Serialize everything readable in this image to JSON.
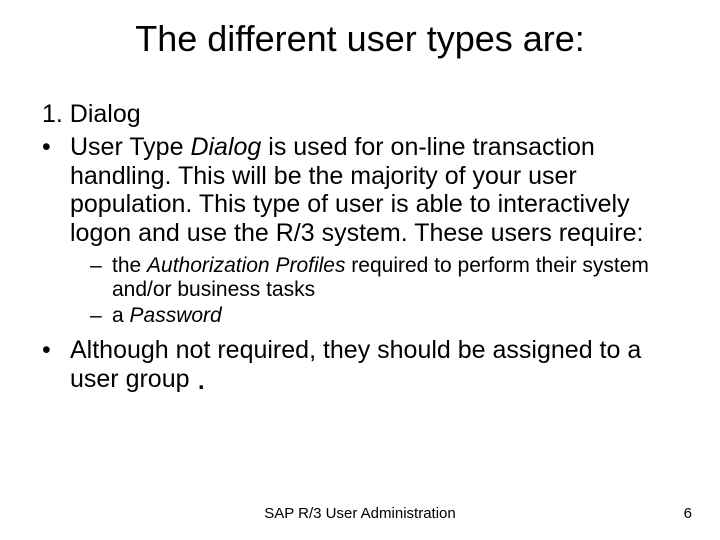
{
  "title": "The different user types are:",
  "item1_heading": "1. Dialog",
  "bullet1_pre": "User Type ",
  "bullet1_em": "Dialog",
  "bullet1_post": " is used for on-line transaction handling. This will be the majority of your user population. This type of user is able to interactively logon and use the R/3 system. These users require:",
  "sub1_pre": "the ",
  "sub1_em": "Authorization Profiles",
  "sub1_post": " required to perform their system and/or business tasks",
  "sub2_pre": "a ",
  "sub2_em": "Password",
  "bullet2": "Although not required, they should be assigned to a user group ",
  "footer_center": "SAP R/3 User Administration",
  "footer_right": "6"
}
